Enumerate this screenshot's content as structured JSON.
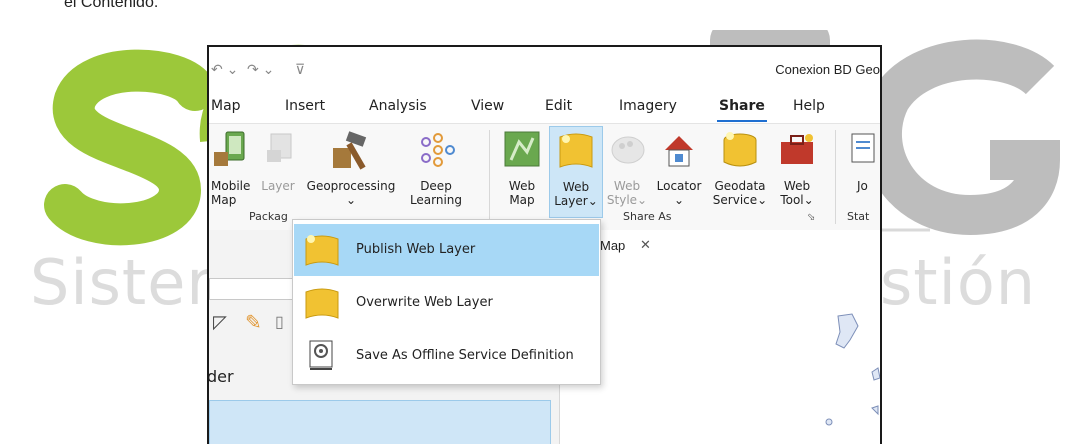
{
  "document": {
    "caption_fragment": "el Contenido."
  },
  "background_logo": {
    "letters_left": "SG",
    "letters_right": "G",
    "subtitle_left": "Sister",
    "subtitle_right": "stión",
    "colors": {
      "green": "#9cc83a",
      "gray": "#bdbdbd",
      "light_gray": "#dcdcdc"
    }
  },
  "window": {
    "title": "Conexion BD Geo",
    "quick_access": [
      "undo-icon",
      "redo-icon",
      "customize-icon"
    ],
    "tabs": [
      {
        "label": "Map"
      },
      {
        "label": "Insert"
      },
      {
        "label": "Analysis"
      },
      {
        "label": "View"
      },
      {
        "label": "Edit"
      },
      {
        "label": "Imagery"
      },
      {
        "label": "Share",
        "active": true
      },
      {
        "label": "Help"
      }
    ],
    "ribbon": {
      "buttons": {
        "mobile_map": "Mobile\nMap",
        "layer": "Layer",
        "geoprocessing": "Geoprocessing\n⌄",
        "deep_learning": "Deep\nLearning",
        "web_map": "Web\nMap",
        "web_layer": "Web\nLayer⌄",
        "web_style": "Web\nStyle⌄",
        "locator": "Locator\n⌄",
        "geodata_service": "Geodata\nService⌄",
        "web_tool": "Web\nTool⌄",
        "job": "Jo"
      },
      "groups": {
        "package": "Packag",
        "share_as": "Share As",
        "status": "Stat"
      }
    },
    "map_tab": {
      "label": "Map",
      "close": "✕"
    },
    "left_pane": {
      "label": "der"
    }
  },
  "dropdown": {
    "items": [
      {
        "label": "Publish Web Layer",
        "highlighted": true,
        "icon": "publish-web-layer-icon"
      },
      {
        "label": "Overwrite Web Layer",
        "icon": "overwrite-web-layer-icon"
      },
      {
        "label": "Save As Offline Service Definition",
        "icon": "service-definition-icon"
      }
    ]
  },
  "colors": {
    "accent": "#1f6fd1",
    "highlight": "#a7d8f6",
    "active_button": "#cde6f7"
  }
}
